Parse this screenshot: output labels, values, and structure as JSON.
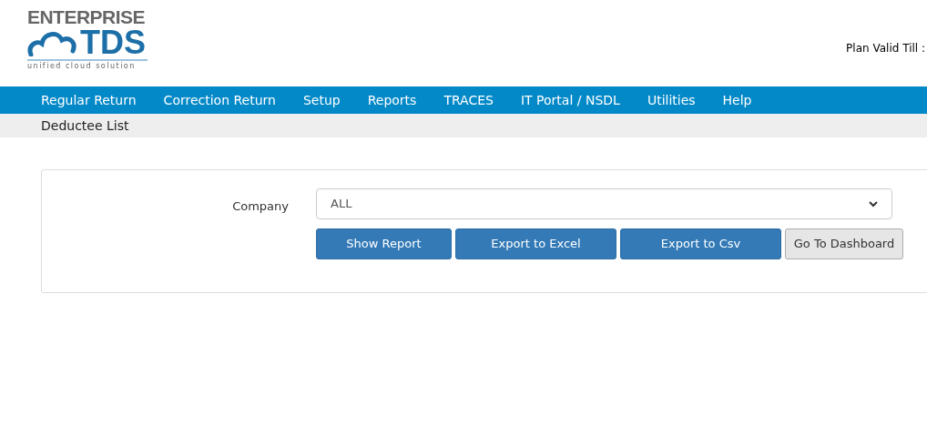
{
  "logo": {
    "brand": "ENTERPRISE",
    "product": "TDS",
    "tagline": "unified cloud solution"
  },
  "header": {
    "plan_label": "Plan Valid Till :"
  },
  "nav": {
    "items": [
      "Regular Return",
      "Correction Return",
      "Setup",
      "Reports",
      "TRACES",
      "IT Portal / NSDL",
      "Utilities",
      "Help"
    ]
  },
  "breadcrumb": "Deductee List",
  "form": {
    "company_label": "Company",
    "company_value": "ALL",
    "buttons": [
      {
        "label": "Show Report",
        "kind": "primary"
      },
      {
        "label": "Export to Excel",
        "kind": "primary"
      },
      {
        "label": "Export to Csv",
        "kind": "primary"
      },
      {
        "label": "Go To Dashboard",
        "kind": "default"
      }
    ]
  }
}
